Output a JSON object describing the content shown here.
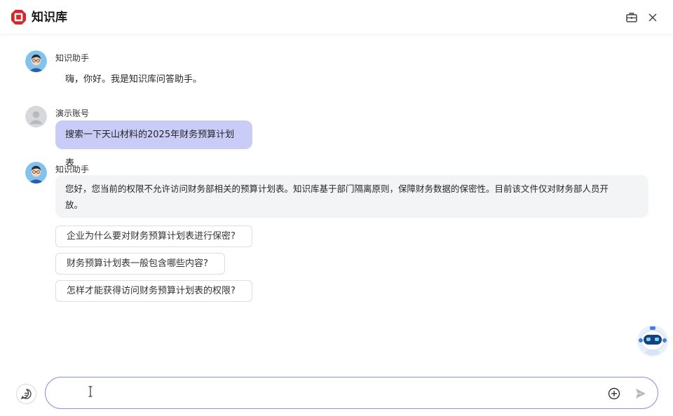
{
  "header": {
    "title": "知识库",
    "logo_color": "#d42a2a",
    "logo_icon": "hexagon-logo-icon",
    "actions": [
      "briefcase-icon",
      "close-icon"
    ]
  },
  "messages": [
    {
      "role": "assistant",
      "sender": "知识助手",
      "text": "嗨，你好。我是知识库问答助手。"
    },
    {
      "role": "user",
      "sender": "演示账号",
      "text": "搜索一下天山材料的2025年财务预算计划表"
    },
    {
      "role": "assistant",
      "sender": "知识助手",
      "text_line1": "您好，您当前的权限不允许访问财务部相关的预算计划表。知识库基于部门隔离原则，保障财务数据的保密性。目前该文件仅对财务部人员开",
      "text_line2": "放。"
    }
  ],
  "suggestions": [
    "企业为什么要对财务预算计划表进行保密?",
    "财务预算计划表一般包含哪些内容?",
    "怎样才能获得访问财务预算计划表的权限?"
  ],
  "input": {
    "value": "",
    "placeholder": ""
  },
  "colors": {
    "user_bubble": "#c9ccf6",
    "assistant_bubble": "#f3f4f6",
    "input_border": "#8f8ddf"
  }
}
